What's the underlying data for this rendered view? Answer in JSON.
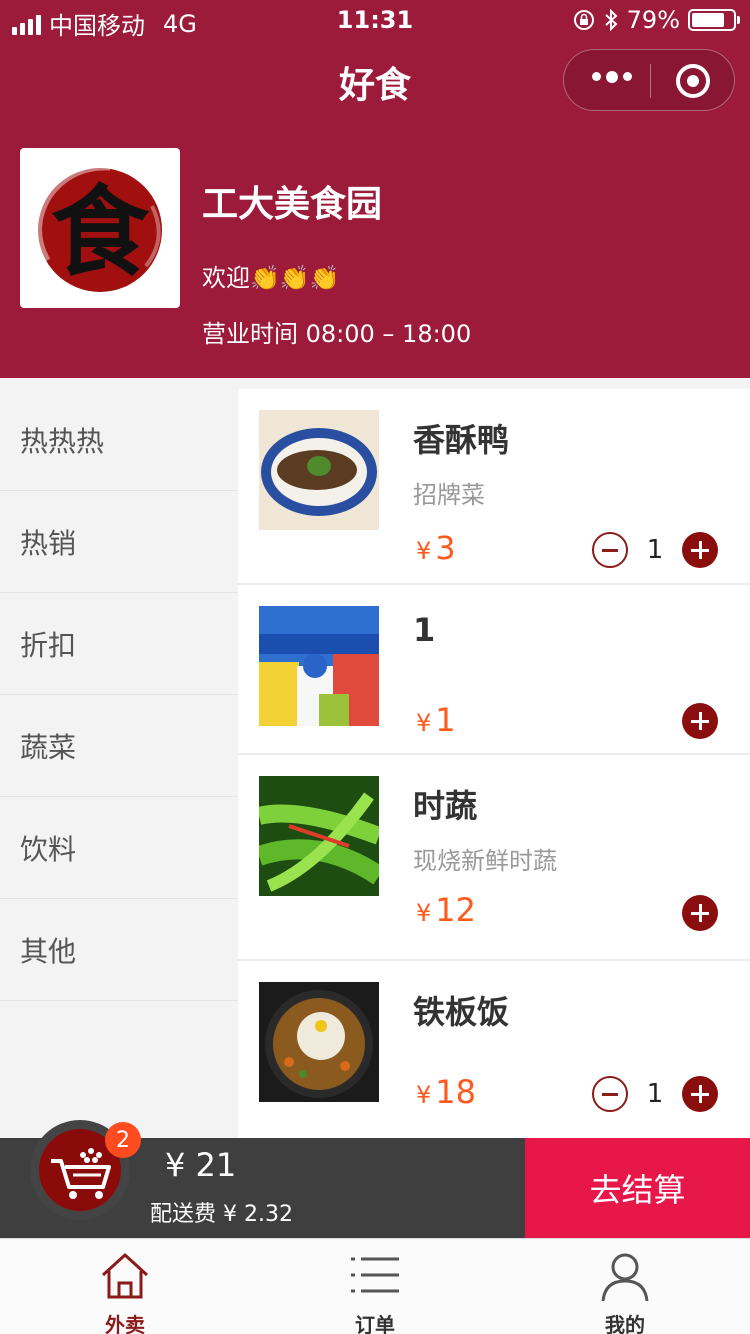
{
  "status_bar": {
    "carrier": "中国移动",
    "network": "4G",
    "time": "11:31",
    "battery": "79%",
    "battery_level": 0.79
  },
  "nav": {
    "title": "好食"
  },
  "store": {
    "logo_glyph": "食",
    "name": "工大美食园",
    "welcome": "欢迎👏👏👏",
    "hours": "营业时间 08:00 – 18:00"
  },
  "categories": [
    "热热热",
    "热销",
    "折扣",
    "蔬菜",
    "饮料",
    "其他"
  ],
  "dishes": [
    {
      "name": "香酥鸭",
      "desc": "招牌菜",
      "currency": "¥",
      "price": "3",
      "qty": "1"
    },
    {
      "name": "1",
      "desc": "",
      "currency": "¥",
      "price": "1",
      "qty": ""
    },
    {
      "name": "时蔬",
      "desc": "现烧新鲜时蔬",
      "currency": "¥",
      "price": "12",
      "qty": ""
    },
    {
      "name": "铁板饭",
      "desc": "",
      "currency": "¥",
      "price": "18",
      "qty": "1"
    }
  ],
  "cart": {
    "badge": "2",
    "total": "¥ 21",
    "delivery_fee": "配送费 ¥ 2.32",
    "checkout_label": "去结算"
  },
  "tabbar": {
    "items": [
      {
        "label": "外卖",
        "icon": "home-icon",
        "active": true
      },
      {
        "label": "订单",
        "icon": "list-icon",
        "active": false
      },
      {
        "label": "我的",
        "icon": "user-icon",
        "active": false
      }
    ]
  },
  "colors": {
    "brand": "#9c1a3a",
    "accent_price": "#ff5a1e",
    "checkout": "#e8174a",
    "button": "#8b0e0e",
    "tab_active": "#8b1a1a",
    "tab_inactive": "#333333"
  }
}
